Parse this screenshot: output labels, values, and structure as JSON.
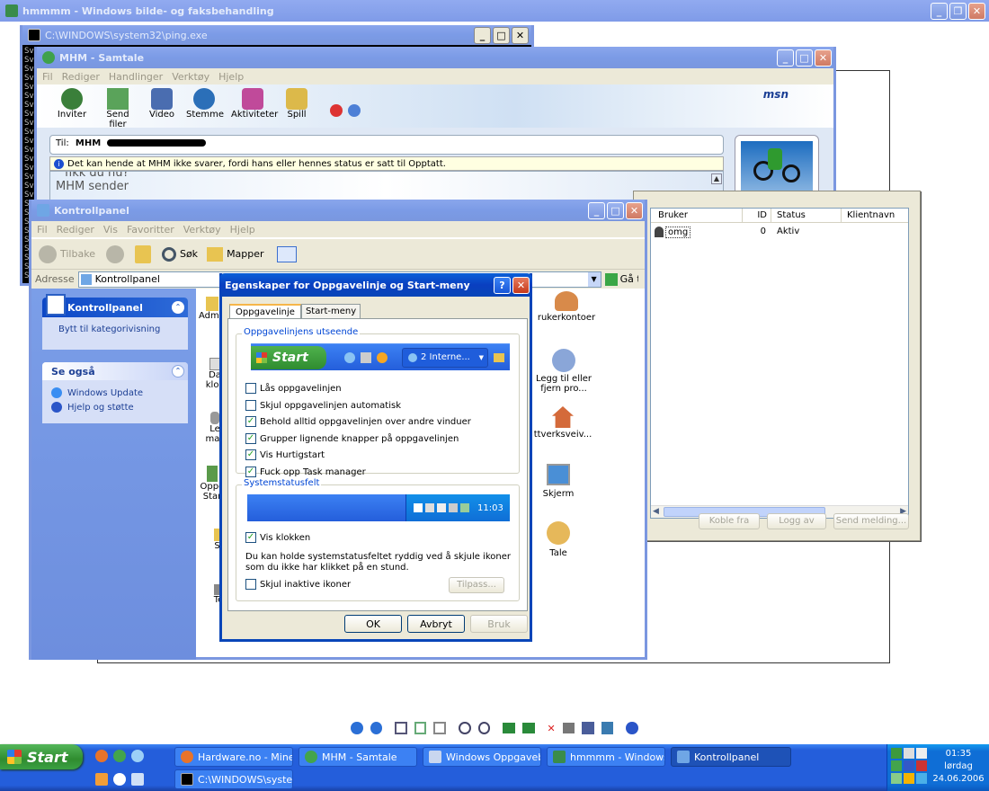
{
  "main_window": {
    "title": "hmmmm - Windows bilde- og faksbehandling"
  },
  "ping_window": {
    "title": "C:\\WINDOWS\\system32\\ping.exe",
    "side_text": "Sv Sv Sv Sv Sv Sv Sv Sv Sv Sv Sv Sv Sv Sv Sv Sv Sv Sv Sv Sv Sv Sv Sv Sv Sv Sv"
  },
  "msn": {
    "title": "MHM - Samtale",
    "menu": [
      "Fil",
      "Rediger",
      "Handlinger",
      "Verktøy",
      "Hjelp"
    ],
    "toolbar": [
      "Inviter",
      "Send filer",
      "Video",
      "Stemme",
      "Aktiviteter",
      "Spill"
    ],
    "logo": "msn",
    "to_label": "Til:",
    "to_name": "MHM",
    "info_text": "Det kan hende at MHM ikke svarer, fordi hans eller hennes status er satt til Opptatt.",
    "chat_line1": "fikk du nu?",
    "chat_line2": "MHM sender"
  },
  "users_window": {
    "columns": [
      "Bruker",
      "ID",
      "Status",
      "Klientnavn"
    ],
    "rows": [
      {
        "user": "omg",
        "id": "0",
        "status": "Aktiv",
        "client": ""
      }
    ],
    "buttons": [
      "Koble fra",
      "Logg av",
      "Send melding..."
    ]
  },
  "control_panel": {
    "title": "Kontrollpanel",
    "menu": [
      "Fil",
      "Rediger",
      "Vis",
      "Favoritter",
      "Verktøy",
      "Hjelp"
    ],
    "toolbar": {
      "back": "Tilbake",
      "search": "Søk",
      "folders": "Mapper"
    },
    "address_label": "Adresse",
    "address_value": "Kontrollpanel",
    "go": "Gå ti",
    "sidebar": {
      "panel1_title": "Kontrollpanel",
      "panel1_link": "Bytt til kategorivisning",
      "panel2_title": "Se også",
      "panel2_links": [
        "Windows Update",
        "Hjelp og støtte"
      ]
    },
    "left_icons": [
      "Admin ve",
      "Da klok",
      "Le mas",
      "Oppg Star",
      "Sl",
      "Te"
    ],
    "right_icons": [
      "rukerkontoer",
      "Legg til eller fjern pro...",
      "ttverksveiv...",
      "Skjerm",
      "Tale"
    ]
  },
  "dialog": {
    "title": "Egenskaper for Oppgavelinje og Start-meny",
    "tabs": [
      "Oppgavelinje",
      "Start-meny"
    ],
    "group1": "Oppgavelinjens utseende",
    "preview_start": "Start",
    "preview_task": "2 Interne...",
    "options": [
      {
        "label": "Lås oppgavelinjen",
        "checked": false
      },
      {
        "label": "Skjul oppgavelinjen automatisk",
        "checked": false
      },
      {
        "label": "Behold alltid oppgavelinjen over andre vinduer",
        "checked": true
      },
      {
        "label": "Grupper lignende knapper på oppgavelinjen",
        "checked": true
      },
      {
        "label": "Vis Hurtigstart",
        "checked": true
      },
      {
        "label": "Fuck opp Task manager",
        "checked": true
      }
    ],
    "group2": "Systemstatusfelt",
    "tray_time": "11:03",
    "show_clock": "Vis klokken",
    "info": "Du kan holde systemstatusfeltet ryddig ved å skjule ikoner som du ikke har klikket på en stund.",
    "hide_inactive": "Skjul inaktive ikoner",
    "customize": "Tilpass...",
    "ok": "OK",
    "cancel": "Avbryt",
    "apply": "Bruk"
  },
  "taskbar": {
    "start": "Start",
    "tasks_row1": [
      "Hardware.no - Mine i...",
      "MHM - Samtale",
      "Windows Oppgavebe...",
      "hmmmm - Windows bil...",
      "Kontrollpanel"
    ],
    "tasks_row2": [
      "C:\\WINDOWS\\syste..."
    ],
    "time": "01:35",
    "day": "lørdag",
    "date": "24.06.2006"
  },
  "colors": {
    "xp_blue": "#0a3fc0",
    "taskbar": "#245edb",
    "sidebar": "#6b8ede"
  }
}
